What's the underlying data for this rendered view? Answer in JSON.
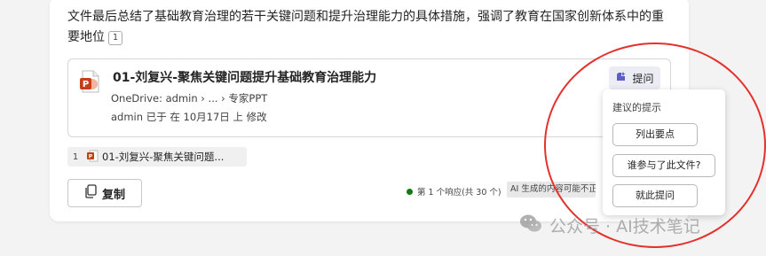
{
  "summary": {
    "text": "文件最后总结了基础教育治理的若干关键问题和提升治理能力的具体措施，强调了教育在国家创新体系中的重要地位",
    "ref": "1"
  },
  "file_card": {
    "title": "01-刘复兴-聚焦关键问题提升基础教育治理能力",
    "path": "OneDrive: admin › ... › 专家PPT",
    "modified": "admin 已于 在 10月17日 上 修改",
    "ask_label": "提问"
  },
  "citation": {
    "num": "1",
    "label": "01-刘复兴-聚焦关键问题..."
  },
  "copy_label": "复制",
  "response_count": "第 1 个响应(共 30 个)",
  "ai_disclaimer": "AI 生成的内容可能不正确",
  "suggestions": {
    "title": "建议的提示",
    "items": [
      "列出要点",
      "谁参与了此文件?",
      "就此提问"
    ]
  },
  "watermark": "公众号 · AI技术笔记",
  "colors": {
    "ppt": "#c43e1c",
    "annotation": "#e5312d",
    "accent": "#5b5fc7"
  }
}
